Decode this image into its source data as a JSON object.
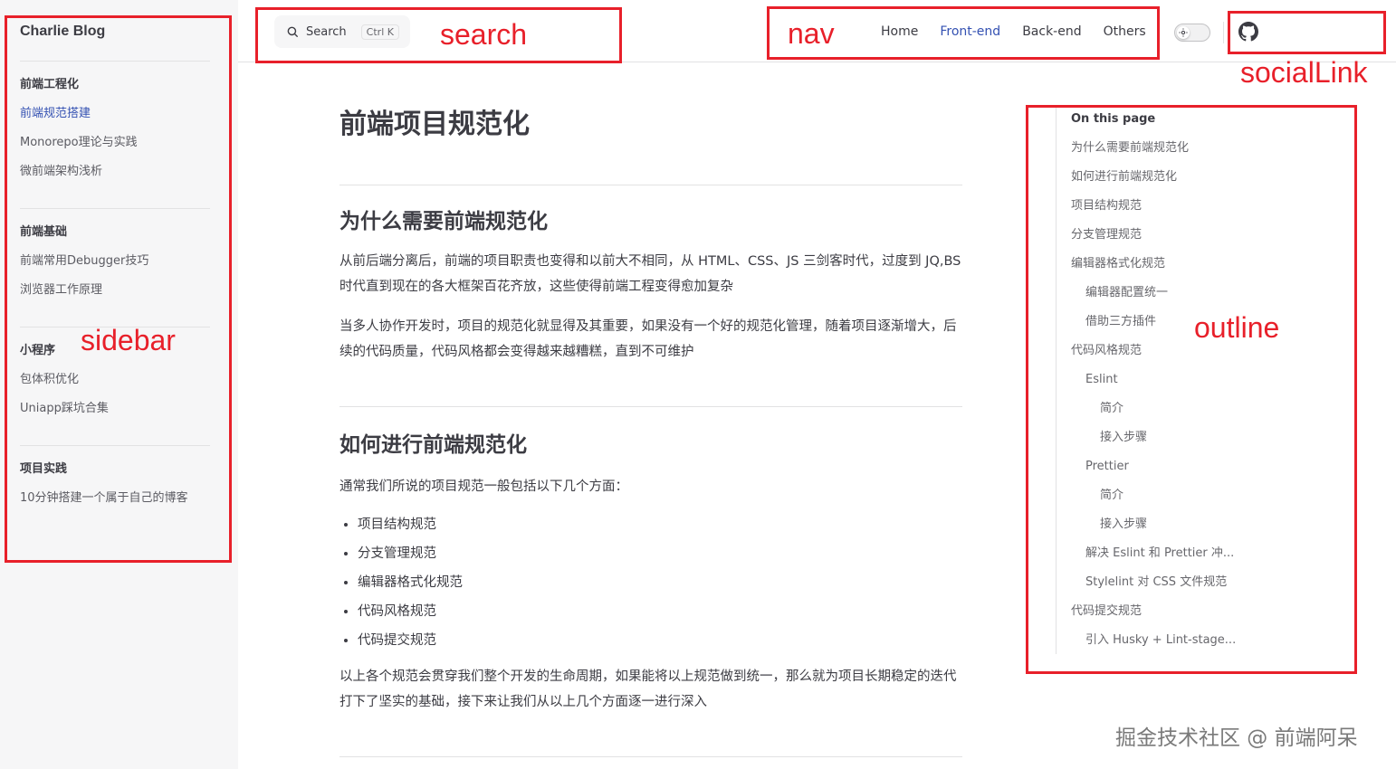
{
  "sidebar": {
    "site_title": "Charlie Blog",
    "groups": [
      {
        "title": "前端工程化",
        "items": [
          "前端规范搭建",
          "Monorepo理论与实践",
          "微前端架构浅析"
        ]
      },
      {
        "title": "前端基础",
        "items": [
          "前端常用Debugger技巧",
          "浏览器工作原理"
        ]
      },
      {
        "title": "小程序",
        "items": [
          "包体积优化",
          "Uniapp踩坑合集"
        ]
      },
      {
        "title": "项目实践",
        "items": [
          "10分钟搭建一个属于自己的博客"
        ]
      }
    ],
    "active_item": "前端规范搭建"
  },
  "search": {
    "label": "Search",
    "shortcut": "Ctrl K"
  },
  "nav": {
    "links": [
      "Home",
      "Front-end",
      "Back-end",
      "Others"
    ],
    "active": "Front-end"
  },
  "content": {
    "title": "前端项目规范化",
    "sections": [
      {
        "heading": "为什么需要前端规范化",
        "paragraphs": [
          "从前后端分离后，前端的项目职责也变得和以前大不相同，从 HTML、CSS、JS 三剑客时代，过度到 JQ,BS 时代直到现在的各大框架百花齐放，这些使得前端工程变得愈加复杂",
          "当多人协作开发时，项目的规范化就显得及其重要，如果没有一个好的规范化管理，随着项目逐渐增大，后续的代码质量，代码风格都会变得越来越糟糕，直到不可维护"
        ]
      },
      {
        "heading": "如何进行前端规范化",
        "intro": "通常我们所说的项目规范一般包括以下几个方面：",
        "list": [
          "项目结构规范",
          "分支管理规范",
          "编辑器格式化规范",
          "代码风格规范",
          "代码提交规范"
        ],
        "outro": "以上各个规范会贯穿我们整个开发的生命周期，如果能将以上规范做到统一，那么就为项目长期稳定的迭代打下了坚实的基础，接下来让我们从以上几个方面逐一进行深入"
      }
    ]
  },
  "outline": {
    "title": "On this page",
    "items": [
      {
        "text": "为什么需要前端规范化",
        "level": 0
      },
      {
        "text": "如何进行前端规范化",
        "level": 0
      },
      {
        "text": "项目结构规范",
        "level": 0
      },
      {
        "text": "分支管理规范",
        "level": 0
      },
      {
        "text": "编辑器格式化规范",
        "level": 0
      },
      {
        "text": "编辑器配置统一",
        "level": 1
      },
      {
        "text": "借助三方插件",
        "level": 1
      },
      {
        "text": "代码风格规范",
        "level": 0
      },
      {
        "text": "Eslint",
        "level": 1
      },
      {
        "text": "简介",
        "level": 2
      },
      {
        "text": "接入步骤",
        "level": 2
      },
      {
        "text": "Prettier",
        "level": 1
      },
      {
        "text": "简介",
        "level": 2
      },
      {
        "text": "接入步骤",
        "level": 2
      },
      {
        "text": "解决 Eslint 和 Prettier 冲...",
        "level": 1
      },
      {
        "text": "Stylelint 对 CSS 文件规范",
        "level": 1
      },
      {
        "text": "代码提交规范",
        "level": 0
      },
      {
        "text": "引入 Husky + Lint-stage...",
        "level": 1
      }
    ]
  },
  "annotations": {
    "search": "search",
    "nav": "nav",
    "socialLink": "socialLink",
    "sidebar": "sidebar",
    "outline": "outline",
    "color": "#e8202a"
  },
  "watermark": "掘金技术社区 @ 前端阿呆",
  "icons": {
    "search": "search-icon",
    "theme": "sun-icon",
    "social": "github-icon"
  },
  "colors": {
    "brand": "#3451b2",
    "sidebar_bg": "#f6f6f7",
    "text": "#3c3c43",
    "annotation": "#e8202a"
  }
}
